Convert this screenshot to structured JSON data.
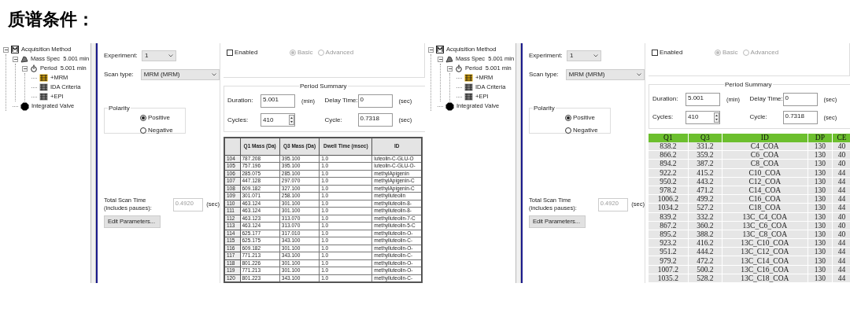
{
  "heading": "质谱条件：",
  "panels": [
    {
      "tree": [
        {
          "label": "Acquisition Method",
          "kind": "method",
          "expanded": true,
          "children": [
            {
              "label": "Mass Spec  5.001 min",
              "kind": "ms",
              "expanded": true,
              "children": [
                {
                  "label": "Period  5.001 min",
                  "kind": "period",
                  "expanded": true,
                  "children": [
                    {
                      "label": "+MRM",
                      "kind": "experiment-active"
                    },
                    {
                      "label": "IDA Criteria",
                      "kind": "experiment"
                    },
                    {
                      "label": "+EPI",
                      "kind": "experiment"
                    }
                  ]
                }
              ]
            },
            {
              "label": "Integrated Valve",
              "kind": "valve"
            }
          ]
        }
      ],
      "form": {
        "experiment_label": "Experiment:",
        "experiment_value": "1",
        "scan_type_label": "Scan type:",
        "scan_type_value": "MRM (MRM)",
        "polarity": {
          "title": "Polarity",
          "options": [
            {
              "label": "Positive",
              "selected": true
            },
            {
              "label": "Negative",
              "selected": false
            }
          ]
        },
        "total_scan_label": "Total Scan Time\n(includes pauses):",
        "total_scan_value": "0.4920",
        "total_scan_disabled": true,
        "total_scan_unit": "(sec)",
        "edit_button": "Edit Parameters..."
      },
      "scheduled": {
        "enabled_label": "Enabled",
        "checked": false,
        "options": [
          {
            "label": "Basic",
            "selected": true
          },
          {
            "label": "Advanced",
            "selected": false
          }
        ]
      },
      "period_summary": {
        "title": "Period Summary",
        "fields": [
          {
            "label": "Duration:",
            "value": "5.001",
            "unit": "(min)"
          },
          {
            "label": "Delay Time:",
            "value": "0",
            "unit": "(sec)"
          },
          {
            "label": "Cycles:",
            "value": "410",
            "kind": "spinner"
          },
          {
            "label": "Cycle:",
            "value": "0.7318",
            "unit": "(sec)"
          }
        ]
      },
      "table": {
        "kind": "grid",
        "columns": [
          "Q1 Mass (Da)",
          "Q3 Mass (Da)",
          "Dwell Time (msec)",
          "ID"
        ],
        "rows": [
          {
            "index": "104",
            "cells": [
              "787.208",
              "395.100",
              "1.0",
              "luteolin-C-GLU-O"
            ]
          },
          {
            "index": "105",
            "cells": [
              "757.196",
              "395.100",
              "1.0",
              "luteolin-C-GLU-O-"
            ]
          },
          {
            "index": "106",
            "cells": [
              "285.075",
              "285.100",
              "1.0",
              "methylApigenin"
            ]
          },
          {
            "index": "107",
            "cells": [
              "447.128",
              "297.070",
              "1.0",
              "methylApigenin-C"
            ]
          },
          {
            "index": "108",
            "cells": [
              "609.182",
              "327.100",
              "1.0",
              "methylApigenin-C"
            ]
          },
          {
            "index": "109",
            "cells": [
              "301.071",
              "258.100",
              "1.0",
              "methylluteolin"
            ]
          },
          {
            "index": "110",
            "cells": [
              "463.124",
              "301.100",
              "1.0",
              "methylluteolin-8-"
            ]
          },
          {
            "index": "111",
            "cells": [
              "463.124",
              "301.100",
              "1.0",
              "methylluteolin-8-"
            ]
          },
          {
            "index": "112",
            "cells": [
              "463.123",
              "313.070",
              "1.0",
              "methylluteolin-7-C"
            ]
          },
          {
            "index": "113",
            "cells": [
              "463.124",
              "313.070",
              "1.0",
              "methylluteolin-5-C"
            ]
          },
          {
            "index": "114",
            "cells": [
              "625.177",
              "317.010",
              "1.0",
              "methylluteolin-O-"
            ]
          },
          {
            "index": "115",
            "cells": [
              "625.175",
              "343.100",
              "1.0",
              "methylluteolin-C-"
            ]
          },
          {
            "index": "116",
            "cells": [
              "609.182",
              "301.100",
              "1.0",
              "methylluteolin-O-"
            ]
          },
          {
            "index": "117",
            "cells": [
              "771.213",
              "343.100",
              "1.0",
              "methylluteolin-C-"
            ]
          },
          {
            "index": "118",
            "cells": [
              "801.226",
              "301.100",
              "1.0",
              "methylluteolin-O-"
            ]
          },
          {
            "index": "119",
            "cells": [
              "771.213",
              "301.100",
              "1.0",
              "methylluteolin-O-"
            ]
          },
          {
            "index": "120",
            "cells": [
              "801.223",
              "343.100",
              "1.0",
              "methylluteolin-C-"
            ]
          }
        ]
      }
    },
    {
      "tree": [
        {
          "label": "Acquisition Method",
          "kind": "method",
          "expanded": true,
          "children": [
            {
              "label": "Mass Spec  5.001 min",
              "kind": "ms",
              "expanded": true,
              "children": [
                {
                  "label": "Period  5.001 min",
                  "kind": "period",
                  "expanded": true,
                  "children": [
                    {
                      "label": "+MRM",
                      "kind": "experiment-active"
                    },
                    {
                      "label": "IDA Criteria",
                      "kind": "experiment"
                    },
                    {
                      "label": "+EPI",
                      "kind": "experiment"
                    }
                  ]
                }
              ]
            },
            {
              "label": "Integrated Valve",
              "kind": "valve"
            }
          ]
        }
      ],
      "form": {
        "experiment_label": "Experiment:",
        "experiment_value": "1",
        "scan_type_label": "Scan type:",
        "scan_type_value": "MRM (MRM)",
        "polarity": {
          "title": "Polarity",
          "options": [
            {
              "label": "Positive",
              "selected": true
            },
            {
              "label": "Negative",
              "selected": false
            }
          ]
        },
        "total_scan_label": "Total Scan Time\n(includes pauses):",
        "total_scan_value": "0.4920",
        "total_scan_disabled": true,
        "total_scan_unit": "(sec)",
        "edit_button": "Edit Parameters..."
      },
      "scheduled": {
        "enabled_label": "Enabled",
        "checked": false,
        "options": [
          {
            "label": "Basic",
            "selected": true
          },
          {
            "label": "Advanced",
            "selected": false
          }
        ]
      },
      "period_summary": {
        "title": "Period Summary",
        "fields": [
          {
            "label": "Duration:",
            "value": "5.001",
            "unit": "(min)"
          },
          {
            "label": "Delay Time:",
            "value": "0",
            "unit": "(sec)"
          },
          {
            "label": "Cycles:",
            "value": "410",
            "kind": "spinner"
          },
          {
            "label": "Cycle:",
            "value": "0.7318",
            "unit": "(sec)"
          }
        ]
      },
      "table": {
        "kind": "green",
        "columns": [
          "Q1",
          "Q3",
          "ID",
          "DP",
          "CE"
        ],
        "rows": [
          {
            "cells": [
              "838.2",
              "331.2",
              "C4_COA",
              "130",
              "40"
            ]
          },
          {
            "cells": [
              "866.2",
              "359.2",
              "C6_COA",
              "130",
              "40"
            ]
          },
          {
            "cells": [
              "894.2",
              "387.2",
              "C8_COA",
              "130",
              "40"
            ]
          },
          {
            "cells": [
              "922.2",
              "415.2",
              "C10_COA",
              "130",
              "44"
            ]
          },
          {
            "cells": [
              "950.2",
              "443.2",
              "C12_COA",
              "130",
              "44"
            ]
          },
          {
            "cells": [
              "978.2",
              "471.2",
              "C14_COA",
              "130",
              "44"
            ]
          },
          {
            "cells": [
              "1006.2",
              "499.2",
              "C16_COA",
              "130",
              "44"
            ]
          },
          {
            "cells": [
              "1034.2",
              "527.2",
              "C18_COA",
              "130",
              "44"
            ]
          },
          {
            "cells": [
              "839.2",
              "332.2",
              "13C_C4_COA",
              "130",
              "40"
            ]
          },
          {
            "cells": [
              "867.2",
              "360.2",
              "13C_C6_COA",
              "130",
              "40"
            ]
          },
          {
            "cells": [
              "895.2",
              "388.2",
              "13C_C8_COA",
              "130",
              "40"
            ]
          },
          {
            "cells": [
              "923.2",
              "416.2",
              "13C_C10_COA",
              "130",
              "44"
            ]
          },
          {
            "cells": [
              "951.2",
              "444.2",
              "13C_C12_COA",
              "130",
              "44"
            ]
          },
          {
            "cells": [
              "979.2",
              "472.2",
              "13C_C14_COA",
              "130",
              "44"
            ]
          },
          {
            "cells": [
              "1007.2",
              "500.2",
              "13C_C16_COA",
              "130",
              "44"
            ]
          },
          {
            "cells": [
              "1035.2",
              "528.2",
              "13C_C18_COA",
              "130",
              "44"
            ]
          }
        ]
      }
    }
  ]
}
